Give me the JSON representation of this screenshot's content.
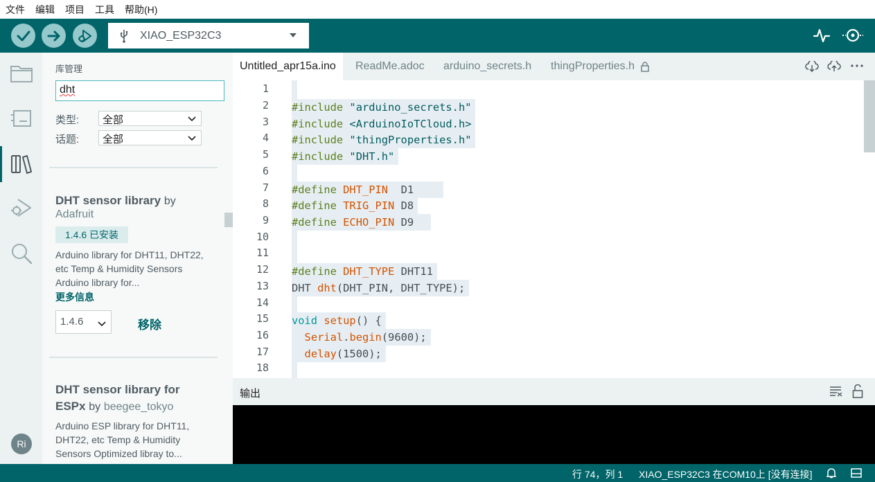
{
  "menu": [
    "文件",
    "编辑",
    "项目",
    "工具",
    "帮助(H)"
  ],
  "toolbar": {
    "board_name": "XIAO_ESP32C3"
  },
  "library": {
    "title": "库管理",
    "search_value": "dht",
    "type_label": "类型:",
    "type_value": "全部",
    "topic_label": "话题:",
    "topic_value": "全部",
    "items": [
      {
        "name": "DHT sensor library",
        "by": "by",
        "author": "Adafruit",
        "installed_badge": "1.4.6 已安装",
        "description": "Arduino library for DHT11, DHT22, etc Temp & Humidity Sensors Arduino library for...",
        "more": "更多信息",
        "version": "1.4.6",
        "remove": "移除"
      },
      {
        "name_line1": "DHT sensor library for",
        "name_line2": "ESPx",
        "by": "by",
        "author": "beegee_tokyo",
        "description": "Arduino ESP library for DHT11, DHT22, etc Temp & Humidity Sensors Optimized libray to..."
      }
    ]
  },
  "avatar_initials": "Ri",
  "tabs": [
    {
      "label": "Untitled_apr15a.ino",
      "active": true
    },
    {
      "label": "ReadMe.adoc",
      "active": false
    },
    {
      "label": "arduino_secrets.h",
      "active": false
    },
    {
      "label": "thingProperties.h",
      "active": false,
      "locked": true
    }
  ],
  "code": {
    "line_numbers": [
      "1",
      "2",
      "3",
      "4",
      "5",
      "6",
      "7",
      "8",
      "9",
      "10",
      "11",
      "12",
      "13",
      "14",
      "15",
      "16",
      "17",
      "18"
    ],
    "lines": [
      "",
      "#include \"arduino_secrets.h\"",
      "#include <ArduinoIoTCloud.h>",
      "#include \"thingProperties.h\"",
      "#include \"DHT.h\"",
      "",
      "#define DHT_PIN  D1    ",
      "#define TRIG_PIN D8",
      "#define ECHO_PIN D9  ",
      "",
      "",
      "#define DHT_TYPE DHT11",
      "DHT dht(DHT_PIN, DHT_TYPE);",
      "",
      "void setup() {",
      "  Serial.begin(9600);",
      "  delay(1500);",
      ""
    ]
  },
  "output": {
    "title": "输出"
  },
  "status": {
    "position": "行 74，列 1",
    "board": "XIAO_ESP32C3 在COM10上 [没有连接]"
  },
  "colors": {
    "toolbar_bg": "#006468",
    "button_bg": "#95c9cc",
    "preprocessor": "#5a7f1e",
    "string": "#005c5f",
    "define_name": "#d35400",
    "keyword": "#00979d"
  }
}
